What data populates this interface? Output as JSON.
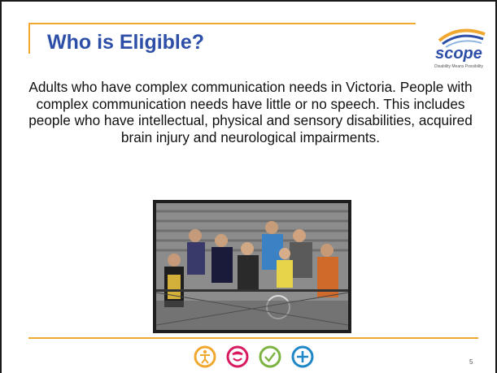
{
  "slide": {
    "title": "Who is Eligible?",
    "body": "Adults who have complex communication needs in Victoria. People with complex communication needs have little or no speech. This includes people who have intellectual, physical and sensory disabilities, acquired brain injury and neurological impairments.",
    "page_number": "5"
  },
  "logo": {
    "name": "scope",
    "tagline": "Disability Means Possibility",
    "color": "#2d4fa8",
    "accent": "#f0a830"
  },
  "photo": {
    "subject": "group-photo"
  },
  "footer_icons": [
    {
      "name": "accessibility-icon",
      "color": "#f0a830"
    },
    {
      "name": "communication-icon",
      "color": "#d81b60"
    },
    {
      "name": "check-icon",
      "color": "#7cb342"
    },
    {
      "name": "plus-icon",
      "color": "#1e88c8"
    }
  ],
  "colors": {
    "title": "#2d4fa8",
    "rule": "#f0a830"
  }
}
